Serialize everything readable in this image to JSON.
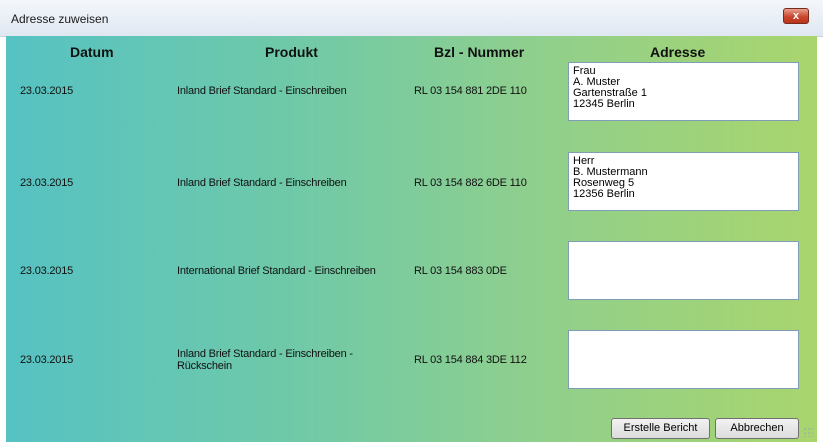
{
  "window": {
    "title": "Adresse zuweisen",
    "close_label": "x"
  },
  "headers": {
    "datum": "Datum",
    "produkt": "Produkt",
    "bzl": "Bzl - Nummer",
    "adresse": "Adresse"
  },
  "rows": [
    {
      "datum": "23.03.2015",
      "produkt": "Inland Brief Standard - Einschreiben",
      "produkt2": "",
      "bzl": "RL  03 154 881  2DE  110",
      "adresse": [
        "Frau",
        "A. Muster",
        "Gartenstraße 1",
        "12345 Berlin"
      ]
    },
    {
      "datum": "23.03.2015",
      "produkt": "Inland Brief Standard - Einschreiben",
      "produkt2": "",
      "bzl": "RL  03 154 882  6DE  110",
      "adresse": [
        "Herr",
        "B. Mustermann",
        "Rosenweg 5",
        "12356 Berlin"
      ]
    },
    {
      "datum": "23.03.2015",
      "produkt": "International Brief Standard - Einschreiben",
      "produkt2": "",
      "bzl": "RL  03 154 883  0DE",
      "adresse": [
        "",
        "",
        "",
        ""
      ]
    },
    {
      "datum": "23.03.2015",
      "produkt": "Inland Brief Standard - Einschreiben -",
      "produkt2": "Rückschein",
      "bzl": "RL  03 154 884  3DE  112",
      "adresse": [
        "",
        "",
        "",
        ""
      ]
    }
  ],
  "buttons": {
    "create": "Erstelle Bericht",
    "cancel": "Abbrechen"
  },
  "colors": {
    "gradient_left": "#56c2c3",
    "gradient_right": "#a9d56d",
    "close": "#c9482d"
  }
}
